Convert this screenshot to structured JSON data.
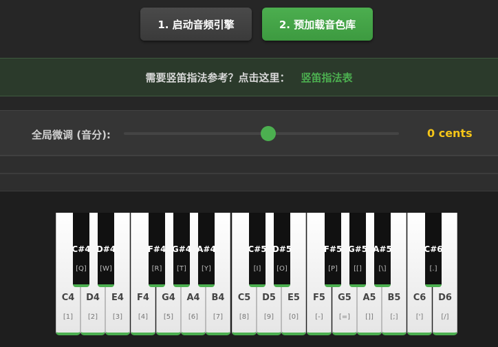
{
  "buttons": {
    "start_audio": "1. 启动音频引擎",
    "preload": "2. 预加载音色库"
  },
  "fingering": {
    "question": "需要竖笛指法参考？点击这里：",
    "link": "竖笛指法表"
  },
  "tune": {
    "label": "全局微调 (音分):",
    "value_text": "0 cents",
    "value": 0
  },
  "colors": {
    "accent": "#4caf50",
    "value": "#f5c518"
  },
  "piano": {
    "white_keys": [
      {
        "note": "C4",
        "key": "[1]"
      },
      {
        "note": "D4",
        "key": "[2]"
      },
      {
        "note": "E4",
        "key": "[3]"
      },
      {
        "note": "F4",
        "key": "[4]"
      },
      {
        "note": "G4",
        "key": "[5]"
      },
      {
        "note": "A4",
        "key": "[6]"
      },
      {
        "note": "B4",
        "key": "[7]"
      },
      {
        "note": "C5",
        "key": "[8]"
      },
      {
        "note": "D5",
        "key": "[9]"
      },
      {
        "note": "E5",
        "key": "[0]"
      },
      {
        "note": "F5",
        "key": "[-]"
      },
      {
        "note": "G5",
        "key": "[=]"
      },
      {
        "note": "A5",
        "key": "[]]"
      },
      {
        "note": "B5",
        "key": "[;]"
      },
      {
        "note": "C6",
        "key": "[']"
      },
      {
        "note": "D6",
        "key": "[/]"
      }
    ],
    "black_keys": [
      {
        "note": "C#4",
        "key": "[Q]"
      },
      {
        "note": "D#4",
        "key": "[W]"
      },
      {
        "note": "F#4",
        "key": "[R]"
      },
      {
        "note": "G#4",
        "key": "[T]"
      },
      {
        "note": "A#4",
        "key": "[Y]"
      },
      {
        "note": "C#5",
        "key": "[I]"
      },
      {
        "note": "D#5",
        "key": "[O]"
      },
      {
        "note": "F#5",
        "key": "[P]"
      },
      {
        "note": "G#5",
        "key": "[[]"
      },
      {
        "note": "A#5",
        "key": "[\\]"
      },
      {
        "note": "C#6",
        "key": "[.]"
      }
    ]
  }
}
